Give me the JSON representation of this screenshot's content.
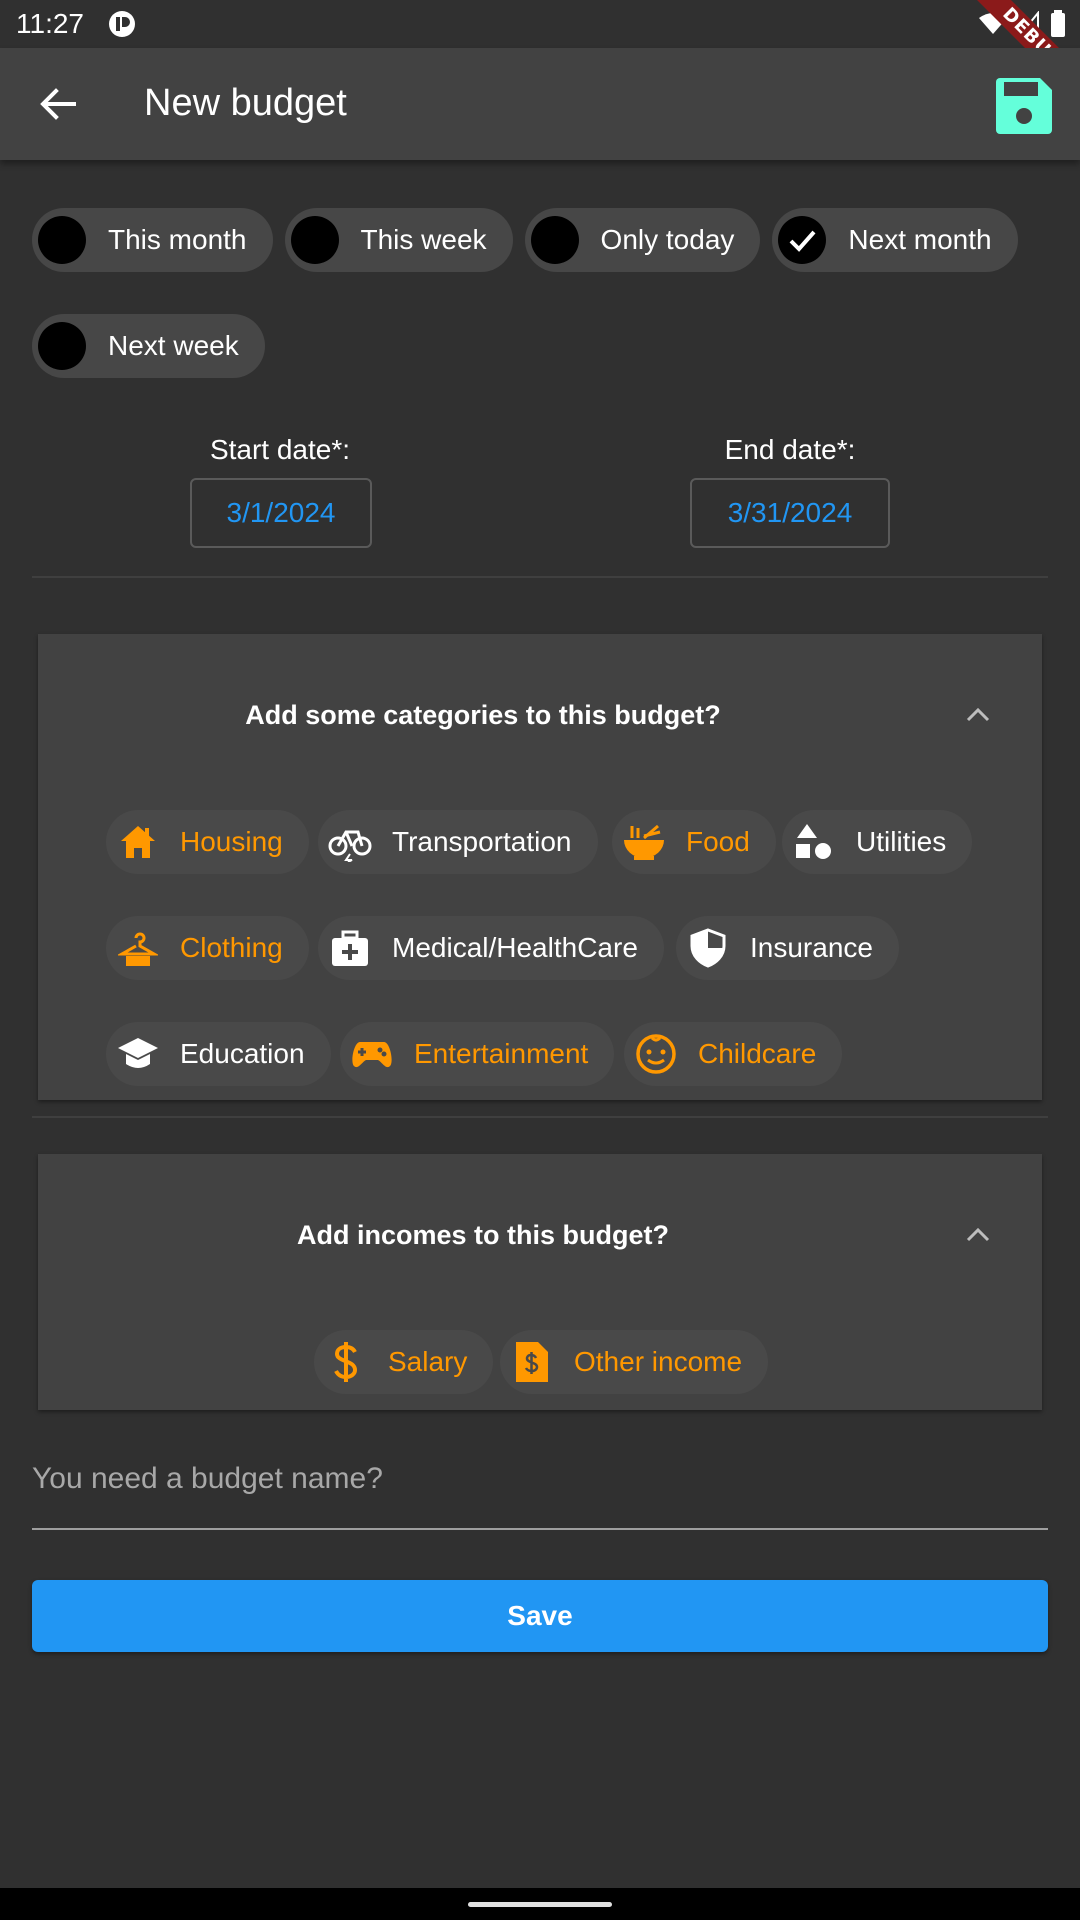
{
  "status_bar": {
    "time": "11:27",
    "debug_label": "DEBUG"
  },
  "app_bar": {
    "title": "New budget",
    "back_icon": "arrow-left-icon",
    "save_icon": "floppy-disk-icon",
    "save_icon_color": "#64ffda"
  },
  "periods": [
    {
      "label": "This month",
      "selected": false
    },
    {
      "label": "This week",
      "selected": false
    },
    {
      "label": "Only today",
      "selected": false
    },
    {
      "label": "Next month",
      "selected": true
    },
    {
      "label": "Next week",
      "selected": false
    }
  ],
  "dates": {
    "start_label": "Start date*:",
    "start_value": "3/1/2024",
    "end_label": "End date*:",
    "end_value": "3/31/2024"
  },
  "categories_panel": {
    "title": "Add some categories to this budget?",
    "chips": [
      {
        "label": "Housing",
        "icon": "house-icon",
        "selected": true
      },
      {
        "label": "Transportation",
        "icon": "bicycle-icon",
        "selected": false
      },
      {
        "label": "Food",
        "icon": "ramen-bowl-icon",
        "selected": true
      },
      {
        "label": "Utilities",
        "icon": "shapes-icon",
        "selected": false
      },
      {
        "label": "Clothing",
        "icon": "hanger-icon",
        "selected": true
      },
      {
        "label": "Medical/HealthCare",
        "icon": "medical-kit-icon",
        "selected": false
      },
      {
        "label": "Insurance",
        "icon": "shield-icon",
        "selected": false
      },
      {
        "label": "Education",
        "icon": "graduation-cap-icon",
        "selected": false
      },
      {
        "label": "Entertainment",
        "icon": "gamepad-icon",
        "selected": true
      },
      {
        "label": "Childcare",
        "icon": "baby-face-icon",
        "selected": true
      }
    ]
  },
  "incomes_panel": {
    "title": "Add incomes to this budget?",
    "chips": [
      {
        "label": "Salary",
        "icon": "dollar-icon",
        "selected": true
      },
      {
        "label": "Other income",
        "icon": "invoice-dollar-icon",
        "selected": true
      }
    ]
  },
  "budget_name": {
    "placeholder": "You need a budget name?",
    "value": ""
  },
  "save_button": {
    "label": "Save"
  },
  "colors": {
    "accent_orange": "#ff9800",
    "primary_blue": "#2196f3",
    "background": "#303030",
    "surface": "#424242"
  }
}
